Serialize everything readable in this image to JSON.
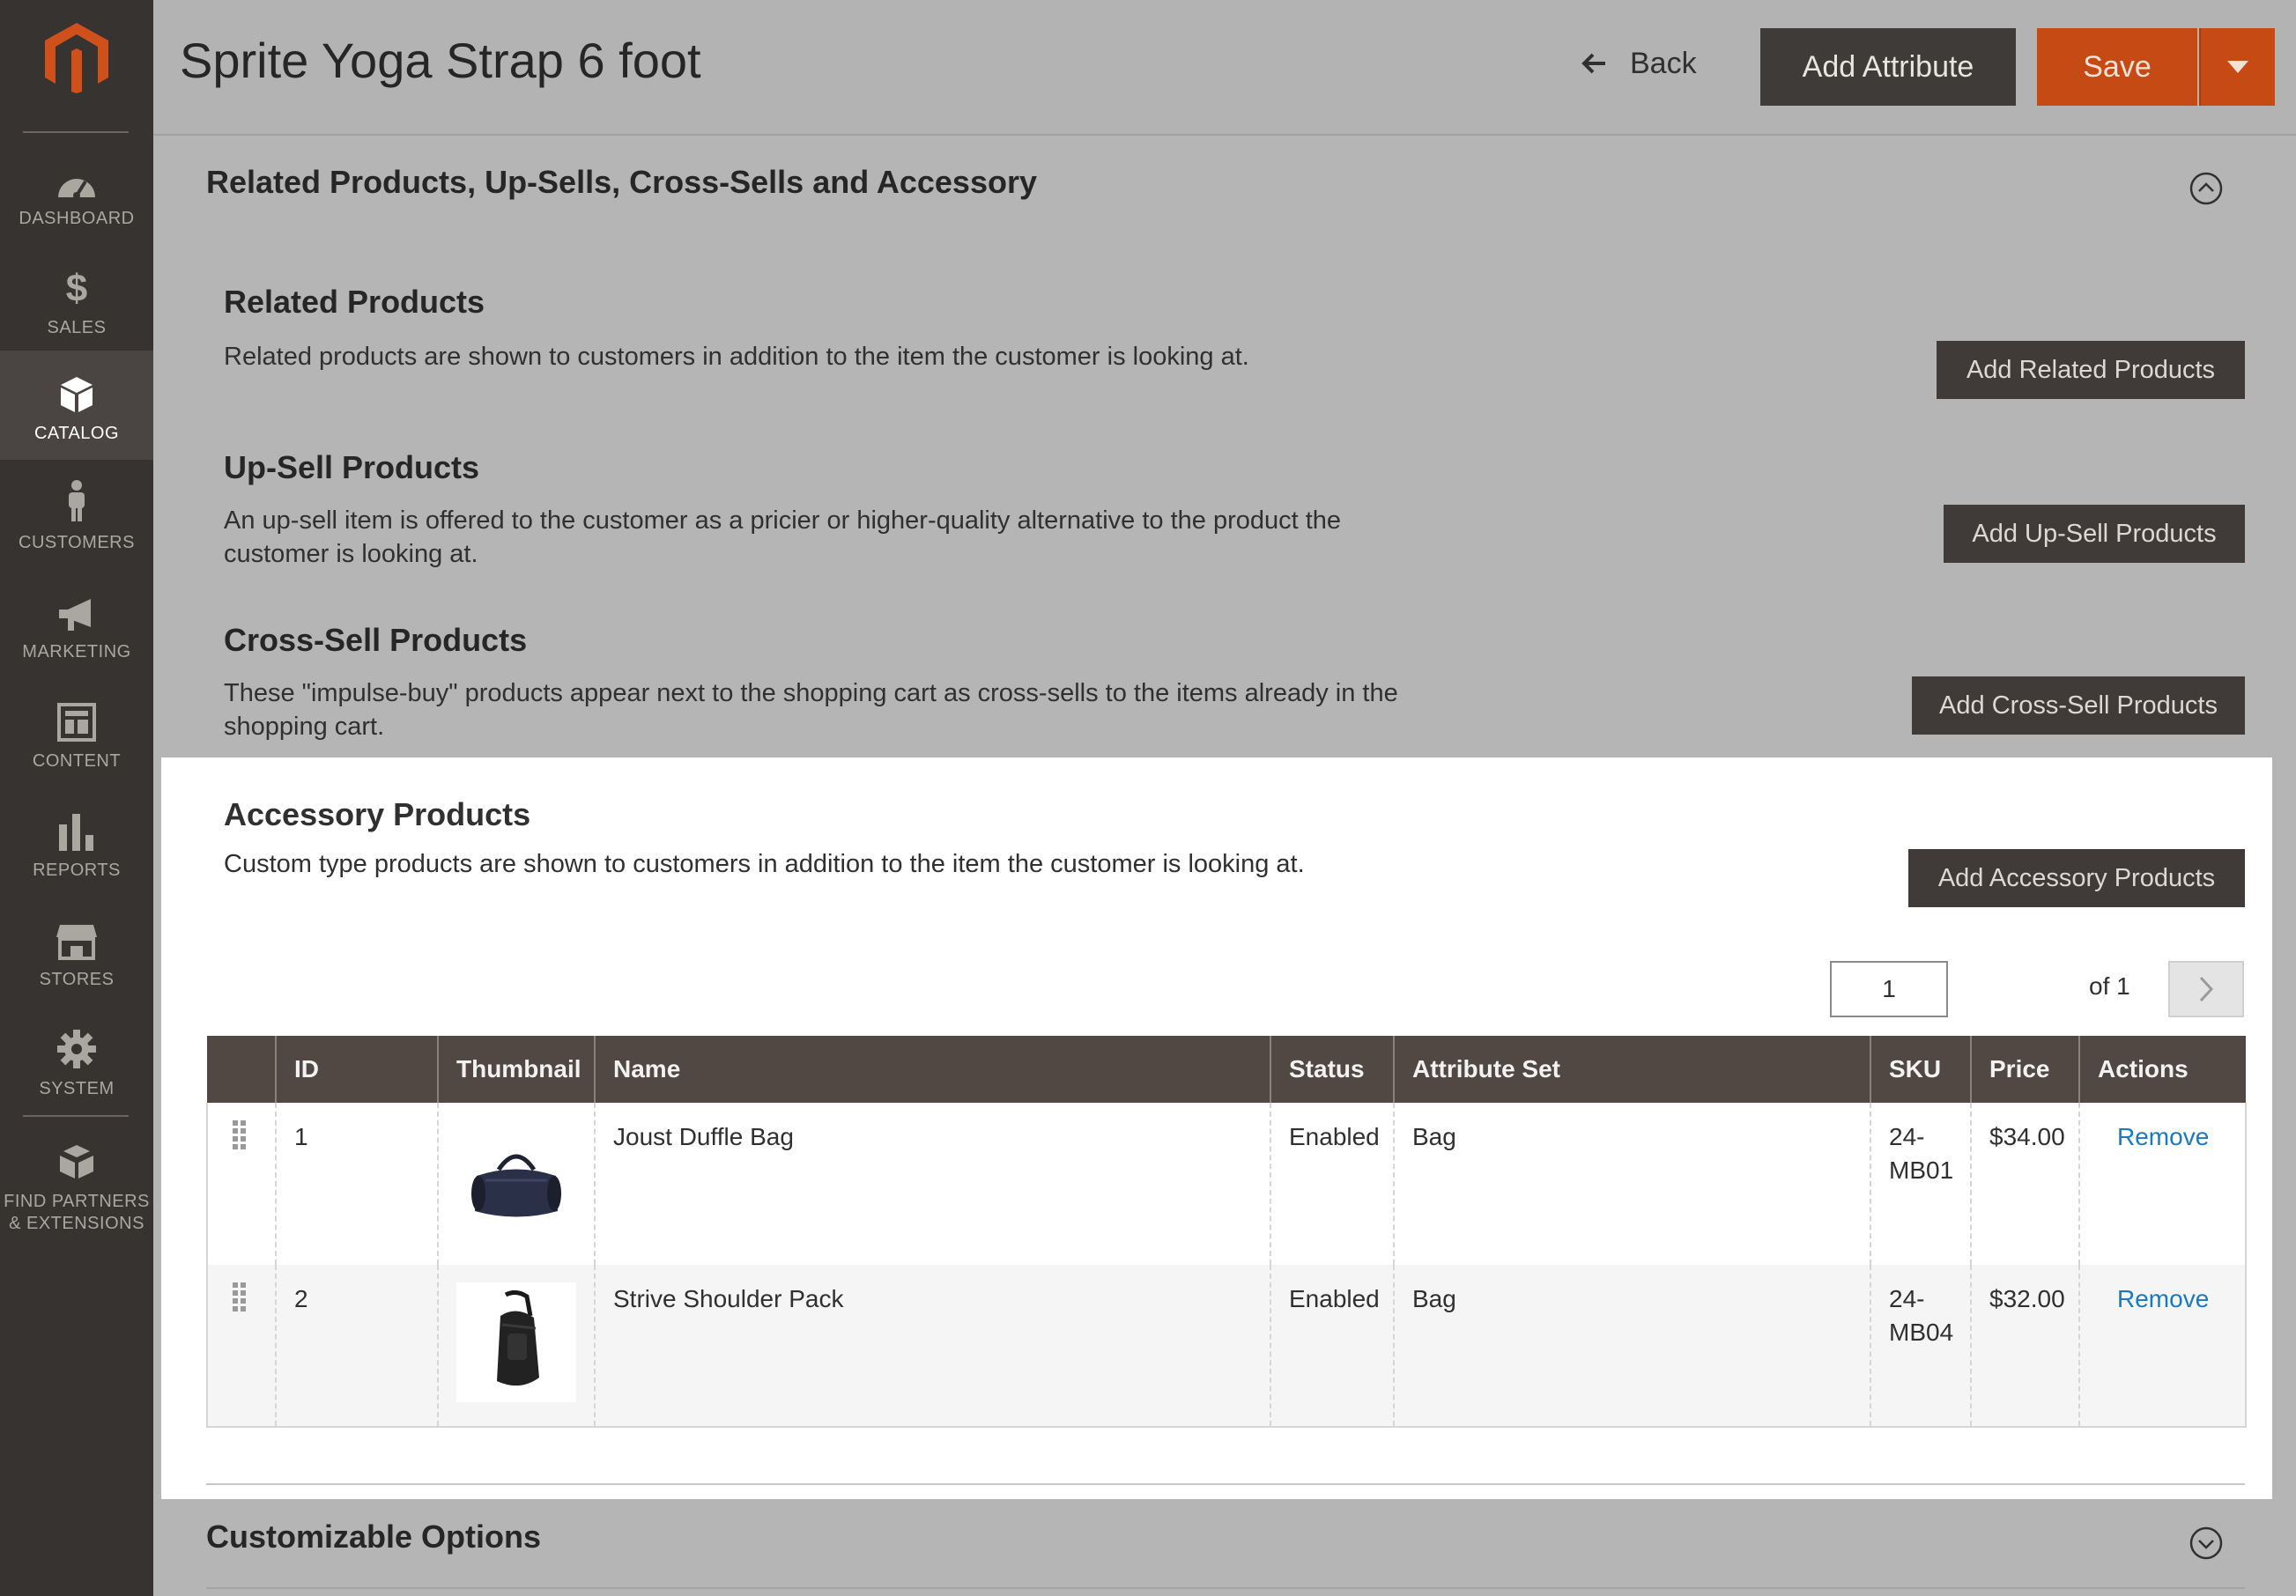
{
  "sidebar": {
    "items": [
      {
        "label": "DASHBOARD",
        "icon": "dashboard-icon"
      },
      {
        "label": "SALES",
        "icon": "dollar-icon"
      },
      {
        "label": "CATALOG",
        "icon": "box-icon"
      },
      {
        "label": "CUSTOMERS",
        "icon": "person-icon"
      },
      {
        "label": "MARKETING",
        "icon": "megaphone-icon"
      },
      {
        "label": "CONTENT",
        "icon": "layout-icon"
      },
      {
        "label": "REPORTS",
        "icon": "bar-chart-icon"
      },
      {
        "label": "STORES",
        "icon": "storefront-icon"
      },
      {
        "label": "SYSTEM",
        "icon": "gear-icon"
      },
      {
        "label_line1": "FIND PARTNERS",
        "label_line2": "& EXTENSIONS",
        "icon": "cubes-icon"
      }
    ],
    "active": "CATALOG"
  },
  "header": {
    "title": "Sprite Yoga Strap 6 foot",
    "back_label": "Back",
    "add_attribute_label": "Add Attribute",
    "save_label": "Save"
  },
  "section": {
    "title": "Related Products, Up-Sells, Cross-Sells and Accessory"
  },
  "blocks": {
    "related": {
      "title": "Related Products",
      "desc": "Related products are shown to customers in addition to the item the customer is looking at.",
      "button": "Add Related Products"
    },
    "upsell": {
      "title": "Up-Sell Products",
      "desc": "An up-sell item is offered to the customer as a pricier or higher-quality alternative to the product the customer is looking at.",
      "button": "Add Up-Sell Products"
    },
    "crosssell": {
      "title": "Cross-Sell Products",
      "desc": "These \"impulse-buy\" products appear next to the shopping cart as cross-sells to the items already in the shopping cart.",
      "button": "Add Cross-Sell Products"
    },
    "accessory": {
      "title": "Accessory Products",
      "desc": "Custom type products are shown to customers in addition to the item the customer is looking at.",
      "button": "Add Accessory Products"
    }
  },
  "pager": {
    "current": "1",
    "of_label": "of 1"
  },
  "grid": {
    "headers": {
      "id": "ID",
      "thumbnail": "Thumbnail",
      "name": "Name",
      "status": "Status",
      "attribute_set": "Attribute Set",
      "sku": "SKU",
      "price": "Price",
      "actions": "Actions"
    },
    "rows": [
      {
        "id": "1",
        "name": "Joust Duffle Bag",
        "status": "Enabled",
        "attribute_set": "Bag",
        "sku_line1": "24-",
        "sku_line2": "MB01",
        "price": "$34.00",
        "action": "Remove"
      },
      {
        "id": "2",
        "name": "Strive Shoulder Pack",
        "status": "Enabled",
        "attribute_set": "Bag",
        "sku_line1": "24-",
        "sku_line2": "MB04",
        "price": "$32.00",
        "action": "Remove"
      }
    ]
  },
  "customizable": {
    "title": "Customizable Options"
  },
  "colors": {
    "sidebar_bg": "#373330",
    "overlay_bg": "#b5b5b5",
    "save_orange": "#c64a13",
    "grid_header": "#514843",
    "link_blue": "#1979c3"
  }
}
